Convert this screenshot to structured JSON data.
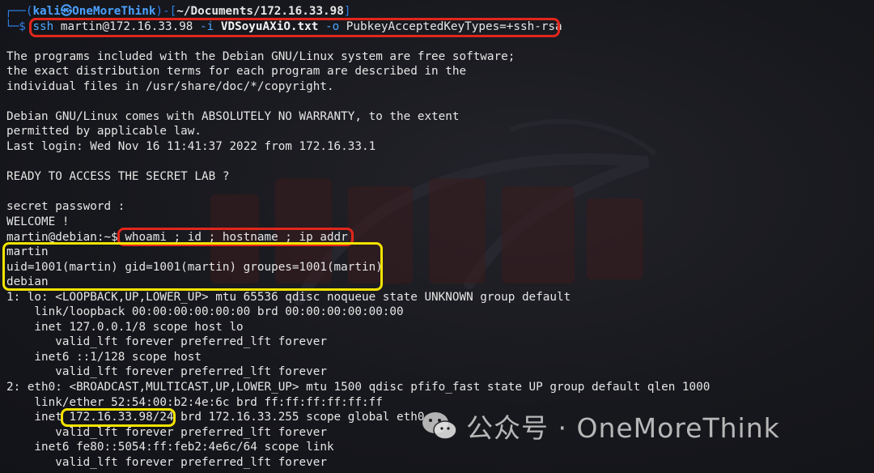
{
  "prompt": {
    "frame_left": "┌──(",
    "user_host": "kali㉿OneMoreThink",
    "frame_mid": ")-[",
    "directory": "~/Documents/172.16.33.98",
    "frame_right": "]",
    "frame_bottom": "└─",
    "dollar": "$"
  },
  "ssh_command": {
    "cmd": "ssh",
    "target": " martin@172.16.33.98 ",
    "opt_i": "-i",
    "keyfile": " VDSoyuAXiO.txt ",
    "opt_o": "-o",
    "option": " PubkeyAcceptedKeyTypes=+ssh-rsa"
  },
  "output_lines": [
    "",
    "The programs included with the Debian GNU/Linux system are free software;",
    "the exact distribution terms for each program are described in the",
    "individual files in /usr/share/doc/*/copyright.",
    "",
    "Debian GNU/Linux comes with ABSOLUTELY NO WARRANTY, to the extent",
    "permitted by applicable law.",
    "Last login: Wed Nov 16 11:41:37 2022 from 172.16.33.1",
    "",
    "READY TO ACCESS THE SECRET LAB ?",
    "",
    "secret password :",
    "WELCOME !"
  ],
  "remote_prompt": "martin@debian:~$ ",
  "remote_command": "whoami ; id ; hostname ; ip addr",
  "result_lines": [
    "martin",
    "uid=1001(martin) gid=1001(martin) groupes=1001(martin)",
    "debian",
    "1: lo: <LOOPBACK,UP,LOWER_UP> mtu 65536 qdisc noqueue state UNKNOWN group default",
    "    link/loopback 00:00:00:00:00:00 brd 00:00:00:00:00:00",
    "    inet 127.0.0.1/8 scope host lo",
    "       valid_lft forever preferred_lft forever",
    "    inet6 ::1/128 scope host",
    "       valid_lft forever preferred_lft forever",
    "2: eth0: <BROADCAST,MULTICAST,UP,LOWER_UP> mtu 1500 qdisc pfifo_fast state UP group default qlen 1000",
    "    link/ether 52:54:00:b2:4e:6c brd ff:ff:ff:ff:ff:ff",
    "    inet 172.16.33.98/24 brd 172.16.33.255 scope global eth0",
    "       valid_lft forever preferred_lft forever",
    "    inet6 fe80::5054:ff:feb2:4e6c/64 scope link",
    "       valid_lft forever preferred_lft forever"
  ],
  "watermark": {
    "icon": "wechat-icon",
    "text": "公众号 · OneMoreThink"
  },
  "colors": {
    "background": "#17181d",
    "prompt_blue": "#2f7fe8",
    "text": "#e6e6e6",
    "highlight_red": "#e1261c",
    "highlight_yellow": "#f4e300"
  }
}
